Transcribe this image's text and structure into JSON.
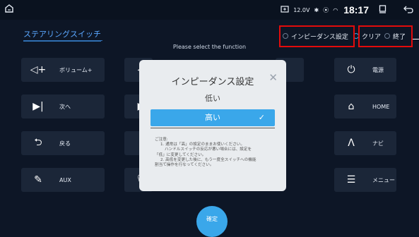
{
  "statusbar": {
    "voltage": "12.0V",
    "time": "18:17",
    "home_icon": "home-outline-icon",
    "icons": [
      "dashcam-icon",
      "bluetooth-icon",
      "location-icon",
      "wifi-icon",
      "window-icon",
      "back-icon"
    ]
  },
  "header": {
    "title": "ステアリングスイッチ",
    "hint": "Please select the function",
    "impedance_label": "インピーダンス設定",
    "clear_label": "クリア",
    "exit_label": "終了"
  },
  "left_buttons": [
    {
      "label": "ボリューム+",
      "icon": "volume-up-icon"
    },
    {
      "label": "次へ",
      "icon": "next-track-icon"
    },
    {
      "label": "戻る",
      "icon": "back-arrow-icon"
    },
    {
      "label": "AUX",
      "icon": "aux-icon"
    }
  ],
  "right_buttons": [
    {
      "label": "電源",
      "icon": "power-icon"
    },
    {
      "label": "HOME",
      "icon": "home-icon"
    },
    {
      "label": "ナビ",
      "icon": "navigation-icon"
    },
    {
      "label": "メニュー",
      "icon": "menu-icon"
    }
  ],
  "modal": {
    "title": "インピーダンス設定",
    "option_low": "低い",
    "option_high": "高い",
    "selected": "高い",
    "note_lines": [
      "ご注意:",
      "1. 通常は「高」の設定のままお使いください。",
      "ハンドルスイッチの反応が悪い場合には、設定を",
      "「低」に変更してください。",
      "2. 高低を変更した後に、もう一度全スイッチへの機能",
      "割当て操作を行なってください。"
    ]
  },
  "confirm_label": "確定",
  "colors": {
    "accent": "#3aa7ea",
    "highlight_box": "#e30b0b",
    "title": "#5aa7ff"
  }
}
